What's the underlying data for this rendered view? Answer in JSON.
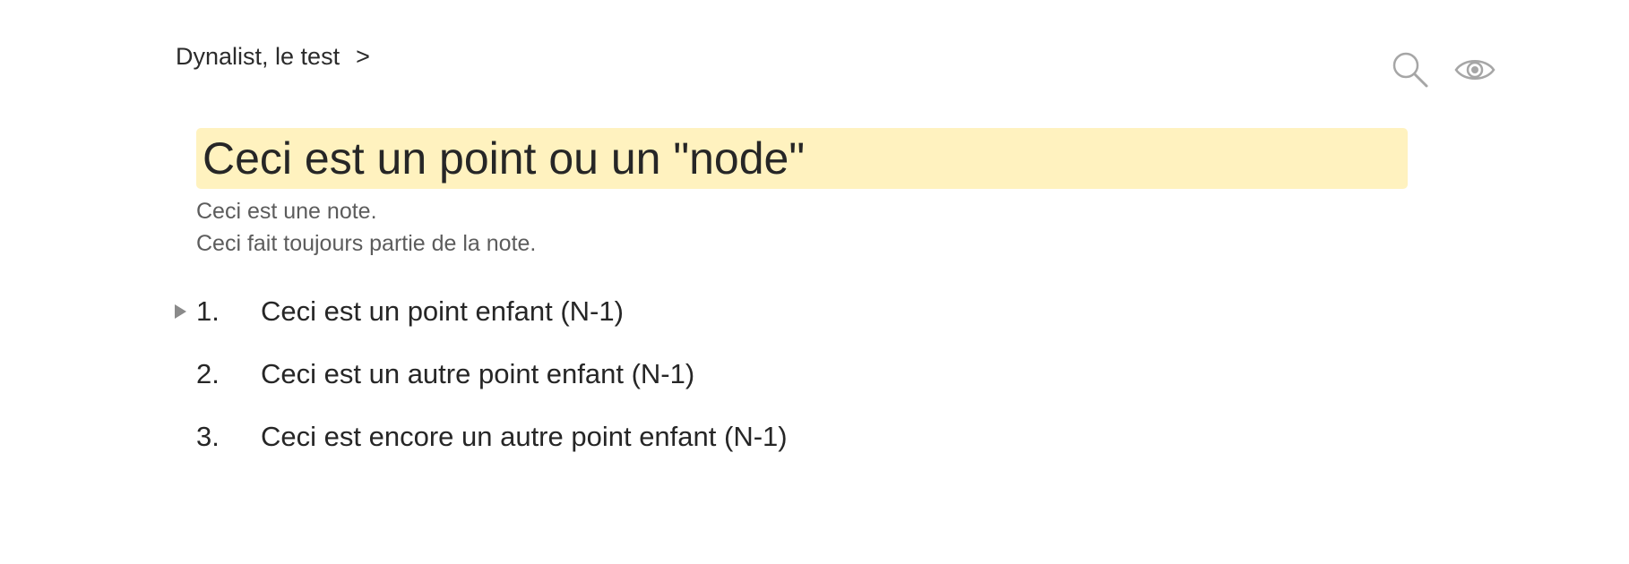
{
  "breadcrumb": {
    "items": [
      "Dynalist, le test"
    ],
    "separator": ">"
  },
  "toolbar": {
    "search_icon": "search-icon",
    "view_icon": "eye-icon",
    "icon_color": "#a6a6a6"
  },
  "node": {
    "title": "Ceci est un point ou un \"node\"",
    "highlight_color": "#fff2bf",
    "note_lines": [
      "Ceci est une note.",
      "Ceci fait toujours partie de la note."
    ]
  },
  "children": [
    {
      "number": "1.",
      "text": "Ceci est un point enfant (N-1)",
      "collapsed": true
    },
    {
      "number": "2.",
      "text": "Ceci est un autre point enfant (N-1)",
      "collapsed": false
    },
    {
      "number": "3.",
      "text": "Ceci est encore un autre point enfant (N-1)",
      "collapsed": false
    }
  ]
}
